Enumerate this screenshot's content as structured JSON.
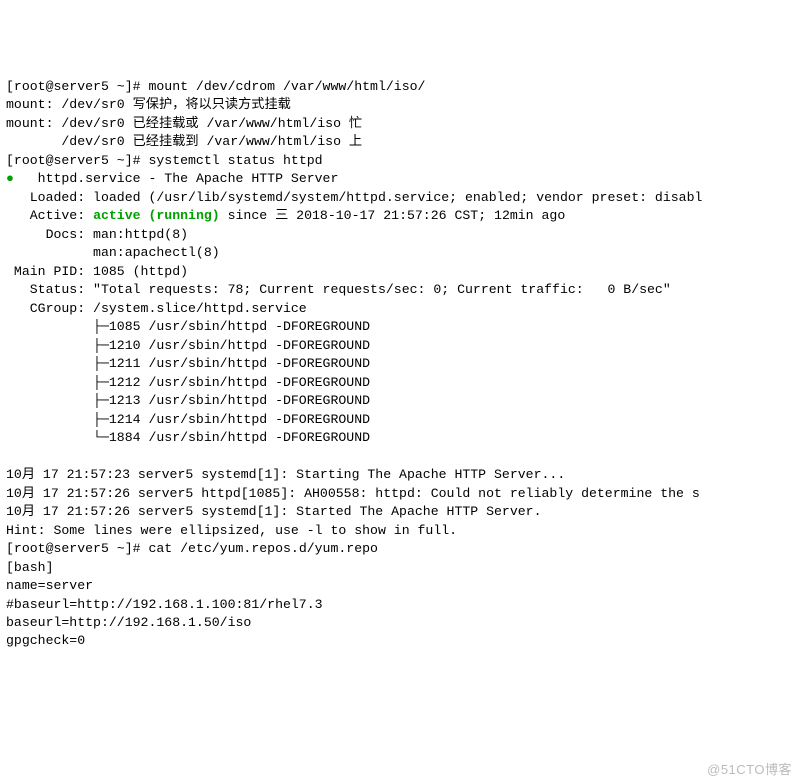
{
  "prompt1": "[root@server5 ~]# ",
  "cmd1": "mount /dev/cdrom /var/www/html/iso/",
  "mount_line1": "mount: /dev/sr0 写保护，将以只读方式挂载",
  "mount_line2": "mount: /dev/sr0 已经挂载或 /var/www/html/iso 忙",
  "mount_line3": "       /dev/sr0 已经挂载到 /var/www/html/iso 上",
  "prompt2": "[root@server5 ~]# ",
  "cmd2": "systemctl status httpd",
  "status_desc": "   httpd.service - The Apache HTTP Server",
  "loaded": "   Loaded: loaded (/usr/lib/systemd/system/httpd.service; enabled; vendor preset: disabl",
  "active_prefix": "   Active: ",
  "active_state": "active (running)",
  "active_suffix": " since 三 2018-10-17 21:57:26 CST; 12min ago",
  "docs1": "     Docs: man:httpd(8)",
  "docs2": "           man:apachectl(8)",
  "mainpid": " Main PID: 1085 (httpd)",
  "status_line": "   Status: \"Total requests: 78; Current requests/sec: 0; Current traffic:   0 B/sec\"",
  "cgroup": "   CGroup: /system.slice/httpd.service",
  "proc1": "           ├─1085 /usr/sbin/httpd -DFOREGROUND",
  "proc2": "           ├─1210 /usr/sbin/httpd -DFOREGROUND",
  "proc3": "           ├─1211 /usr/sbin/httpd -DFOREGROUND",
  "proc4": "           ├─1212 /usr/sbin/httpd -DFOREGROUND",
  "proc5": "           ├─1213 /usr/sbin/httpd -DFOREGROUND",
  "proc6": "           ├─1214 /usr/sbin/httpd -DFOREGROUND",
  "proc7": "           └─1884 /usr/sbin/httpd -DFOREGROUND",
  "blank": "",
  "log1": "10月 17 21:57:23 server5 systemd[1]: Starting The Apache HTTP Server...",
  "log2": "10月 17 21:57:26 server5 httpd[1085]: AH00558: httpd: Could not reliably determine the s",
  "log3": "10月 17 21:57:26 server5 systemd[1]: Started The Apache HTTP Server.",
  "hint": "Hint: Some lines were ellipsized, use -l to show in full.",
  "prompt3": "[root@server5 ~]# ",
  "cmd3": "cat /etc/yum.repos.d/yum.repo",
  "repo1": "[bash]",
  "repo2": "name=server",
  "repo3": "#baseurl=http://192.168.1.100:81/rhel7.3",
  "repo4": "baseurl=http://192.168.1.50/iso",
  "repo5": "gpgcheck=0",
  "watermark": "@51CTO博客",
  "bullet": "●"
}
